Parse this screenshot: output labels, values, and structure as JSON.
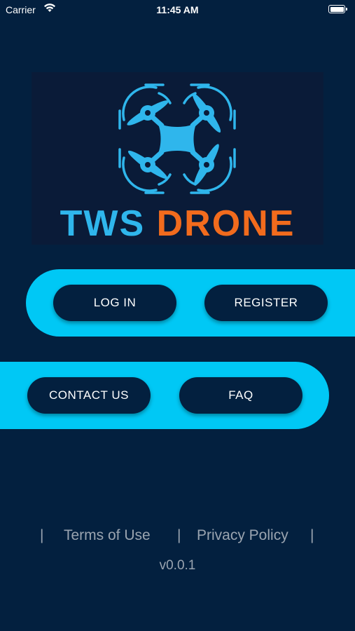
{
  "status_bar": {
    "carrier": "Carrier",
    "time": "11:45 AM"
  },
  "logo": {
    "word1": "TWS",
    "word2": "DRONE",
    "colors": {
      "tws": "#2fb6ec",
      "drone": "#f26b1d",
      "drone_icon": "#2fb6ec"
    }
  },
  "actions": {
    "login_label": "LOG IN",
    "register_label": "REGISTER",
    "contact_label": "CONTACT US",
    "faq_label": "FAQ"
  },
  "footer": {
    "separator": "|",
    "terms_label": "Terms of Use",
    "privacy_label": "Privacy Policy",
    "version": "v0.0.1"
  },
  "theme": {
    "background": "#03203f",
    "accent": "#00c8f5",
    "button": "#03203f"
  }
}
